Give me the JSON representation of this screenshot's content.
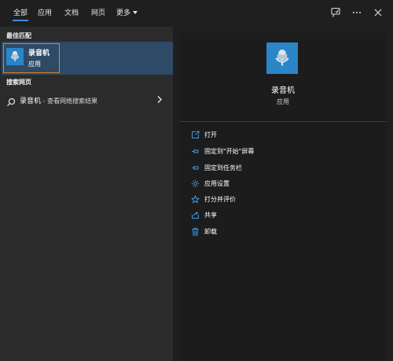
{
  "tabs": [
    {
      "label": "全部",
      "active": true
    },
    {
      "label": "应用"
    },
    {
      "label": "文档"
    },
    {
      "label": "网页"
    }
  ],
  "more_label": "更多",
  "top_icons": [
    "feedback-icon",
    "more-options-icon",
    "close-icon"
  ],
  "left": {
    "best_match_label": "最佳匹配",
    "best_match": {
      "name": "录音机",
      "type": "应用",
      "icon": "recorder-app-icon"
    },
    "web_label": "搜索网页",
    "web_result": {
      "query": "录音机",
      "suffix": " - 查看网络搜索结果"
    }
  },
  "right": {
    "app_name": "录音机",
    "app_type": "应用",
    "actions": [
      {
        "label": "打开",
        "icon": "open-icon"
      },
      {
        "label": "固定到\"开始\"屏幕",
        "icon": "pin-icon"
      },
      {
        "label": "固定到任务栏",
        "icon": "pin-taskbar-icon"
      },
      {
        "label": "应用设置",
        "icon": "gear-icon"
      },
      {
        "label": "打分并评价",
        "icon": "star-icon"
      },
      {
        "label": "共享",
        "icon": "share-icon"
      },
      {
        "label": "卸载",
        "icon": "trash-icon"
      }
    ]
  },
  "colors": {
    "accent": "#3a8ee6",
    "tile": "#2b86c8",
    "highlight": "#2e4a66",
    "focus_border": "#e8831e"
  }
}
